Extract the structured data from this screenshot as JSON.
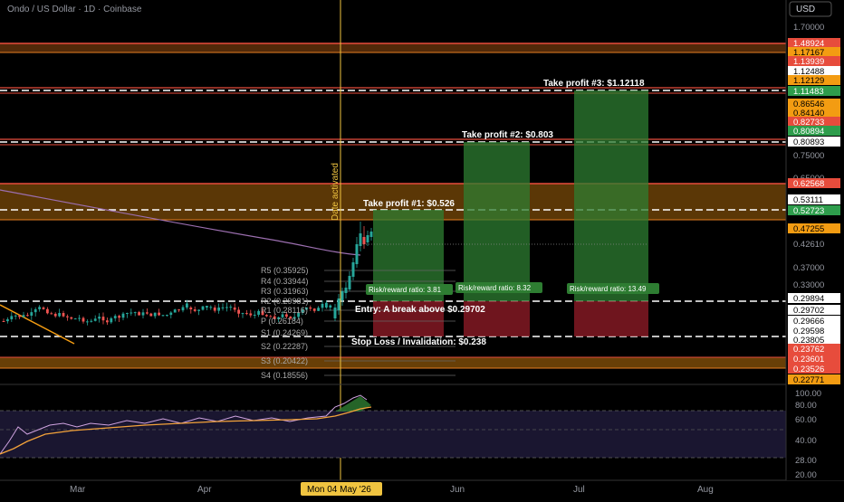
{
  "header": {
    "title": "Ondo / US Dollar · 1D · Coinbase",
    "currency": "USD"
  },
  "colors": {
    "background": "#000000",
    "up": "#26a69a",
    "down": "#ef5350",
    "crosshair": "#f0c440",
    "ma_line": "#9c6fb0",
    "resistance_band": "#7a4a08",
    "profit_zone": "#2e7d32",
    "loss_zone": "#8b1a26",
    "rsi_line": "#f3a23a",
    "rsi_band": "#1a1630"
  },
  "price_axis": {
    "labels": [
      {
        "text": "1.70000",
        "style": "plain"
      },
      {
        "text": "1.48924",
        "style": "red"
      },
      {
        "text": "1.17167",
        "style": "orange"
      },
      {
        "text": "1.13939",
        "style": "red"
      },
      {
        "text": "1.12488",
        "style": "white"
      },
      {
        "text": "1.12129",
        "style": "orange"
      },
      {
        "text": "1.11483",
        "style": "green"
      },
      {
        "text": "0.86546",
        "style": "orange"
      },
      {
        "text": "0.84140",
        "style": "orange"
      },
      {
        "text": "0.82733",
        "style": "red"
      },
      {
        "text": "0.80894",
        "style": "green"
      },
      {
        "text": "0.80893",
        "style": "white"
      },
      {
        "text": "0.75000",
        "style": "plain"
      },
      {
        "text": "0.65000",
        "style": "plain"
      },
      {
        "text": "0.62568",
        "style": "red"
      },
      {
        "text": "0.53111",
        "style": "white"
      },
      {
        "text": "0.52723",
        "style": "green"
      },
      {
        "text": "0.47255",
        "style": "orange"
      },
      {
        "text": "0.42610",
        "style": "plain"
      },
      {
        "text": "0.37000",
        "style": "plain"
      },
      {
        "text": "0.33000",
        "style": "plain"
      },
      {
        "text": "0.29894",
        "style": "white"
      },
      {
        "text": "0.29702",
        "style": "white"
      },
      {
        "text": "0.29666",
        "style": "white"
      },
      {
        "text": "0.29598",
        "style": "white"
      },
      {
        "text": "0.23805",
        "style": "white"
      },
      {
        "text": "0.23762",
        "style": "red"
      },
      {
        "text": "0.23601",
        "style": "red"
      },
      {
        "text": "0.23526",
        "style": "red"
      },
      {
        "text": "0.22771",
        "style": "orange"
      }
    ]
  },
  "rsi_axis": {
    "labels": [
      "100.00",
      "80.00",
      "60.00",
      "40.00",
      "28.00",
      "20.00"
    ]
  },
  "time_axis": {
    "labels": [
      "Mar",
      "Apr",
      "Jun",
      "Jul",
      "Aug"
    ],
    "cursor_label": "Mon 04 May '26"
  },
  "annotations": {
    "date_activated": "Date activated",
    "take_profit_1": "Take profit #1: $0.526",
    "take_profit_2": "Take profit #2: $0.803",
    "take_profit_3": "Take profit #3: $1.12118",
    "entry": "Entry: A break above $0.29702",
    "stop_loss": "Stop Loss / Invalidation: $0.238",
    "rr_1": "Risk/reward ratio: 3.81",
    "rr_2": "Risk/reward ratio: 8.32",
    "rr_3": "Risk/reward ratio: 13.49"
  },
  "pivots": {
    "labels": [
      "R5 (0.35925)",
      "R4 (0.33944)",
      "R3 (0.31963)",
      "R2 (0.29981)",
      "R1 (0.28116)",
      "P (0.26184)",
      "S1 (0.24269)",
      "S2 (0.22287)",
      "S3 (0.20422)",
      "S4 (0.18556)"
    ]
  }
}
